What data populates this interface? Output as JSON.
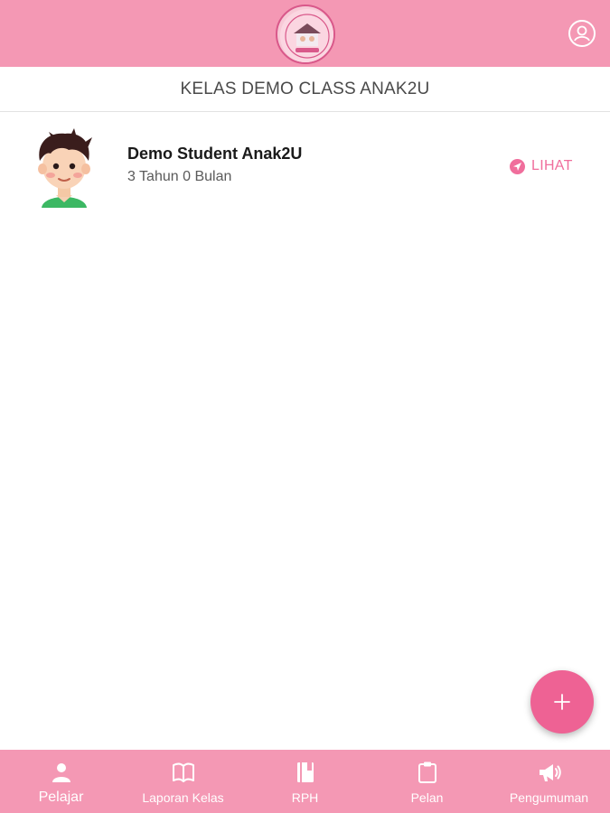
{
  "header": {
    "logo_icon": "school-logo",
    "account_icon": "account-circle-icon"
  },
  "class_title": "KELAS DEMO CLASS ANAK2U",
  "students": [
    {
      "name": "Demo Student Anak2U",
      "age": "3 Tahun 0 Bulan",
      "avatar_icon": "boy-avatar",
      "action_label": "LIHAT",
      "action_icon": "send-icon"
    }
  ],
  "fab": {
    "icon": "plus-icon"
  },
  "bottom_nav": [
    {
      "label": "Pelajar",
      "icon": "person-icon",
      "active": true
    },
    {
      "label": "Laporan Kelas",
      "icon": "book-open-icon",
      "active": false
    },
    {
      "label": "RPH",
      "icon": "notebook-icon",
      "active": false
    },
    {
      "label": "Pelan",
      "icon": "clipboard-icon",
      "active": false
    },
    {
      "label": "Pengumuman",
      "icon": "megaphone-icon",
      "active": false
    }
  ],
  "colors": {
    "brand_pink": "#f498b4",
    "accent_pink": "#ee6294",
    "link_pink": "#f06e9c"
  }
}
